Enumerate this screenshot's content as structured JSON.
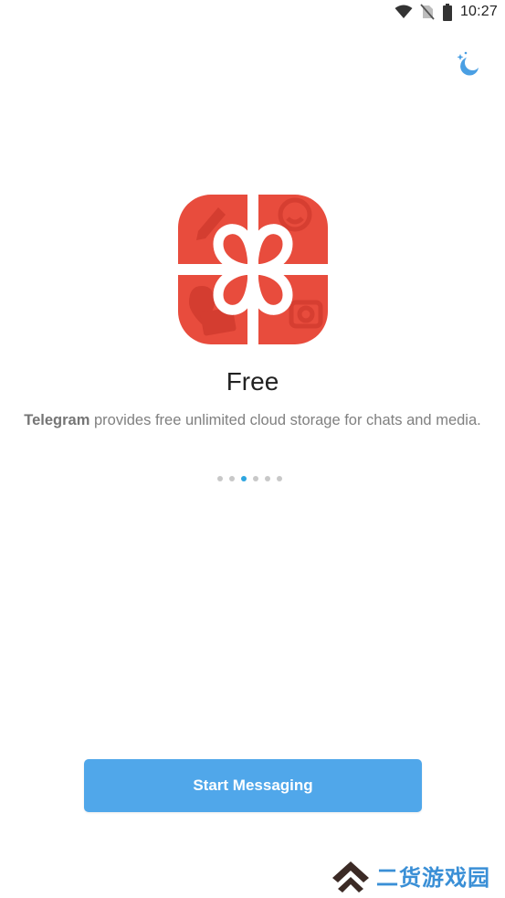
{
  "status_bar": {
    "time": "10:27",
    "icons": [
      "wifi-icon",
      "no-sim-icon",
      "battery-icon"
    ]
  },
  "header": {
    "theme_toggle_icon": "moon-stars-icon"
  },
  "slide": {
    "illustration_icon": "gift-box-icon",
    "title": "Free",
    "description_brand": "Telegram",
    "description_rest": " provides free unlimited cloud storage for chats and media."
  },
  "pager": {
    "total": 6,
    "active_index": 2
  },
  "actions": {
    "start_label": "Start Messaging"
  },
  "watermark": {
    "text": "二货游戏园",
    "logo_icon": "double-chevron-up-icon"
  },
  "colors": {
    "accent": "#50a7ea",
    "dot_active": "#2ea6e0",
    "dot_inactive": "#c8c8c8",
    "gift_red": "#e84c3d",
    "watermark_blue": "#3a8fd6"
  }
}
